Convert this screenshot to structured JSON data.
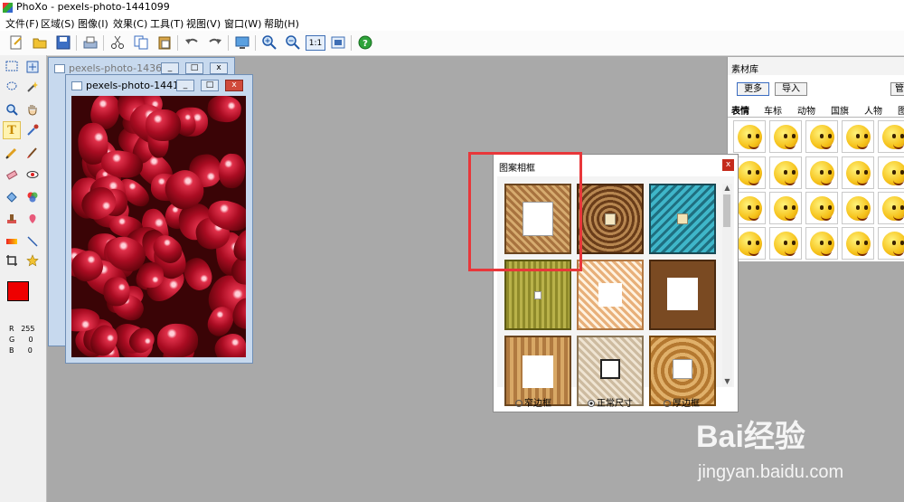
{
  "app": {
    "title": "PhoXo - pexels-photo-1441099"
  },
  "menu": [
    "文件(F)",
    "区域(S)",
    "图像(I)",
    "效果(C)",
    "工具(T)",
    "视图(V)",
    "窗口(W)",
    "帮助(H)"
  ],
  "toolbar": [
    "new-icon",
    "open-icon",
    "save-icon",
    "scan-icon",
    "cut-icon",
    "copy-icon",
    "paste-icon",
    "undo-icon",
    "redo-icon",
    "screen-capture-icon",
    "zoom-in-icon",
    "zoom-out-icon",
    "actual-size-icon",
    "fit-window-icon",
    "help-icon"
  ],
  "toolbar_labels": {
    "actual_size": "1:1"
  },
  "tools": [
    "rect-select-icon",
    "move-icon",
    "lasso-icon",
    "magic-wand-icon",
    "zoom-icon",
    "hand-icon",
    "text-icon",
    "eyedropper-icon",
    "pencil-icon",
    "brush-icon",
    "eraser-icon",
    "redeye-icon",
    "fill-icon",
    "colorize-icon",
    "stamp-icon",
    "heal-icon",
    "gradient-icon",
    "line-icon",
    "crop-icon",
    "star-icon"
  ],
  "colors": {
    "foreground": "#ee0000",
    "background": "#ffffff",
    "r_label": "R",
    "r": "255",
    "g_label": "G",
    "g": "0",
    "b_label": "B",
    "b": "0"
  },
  "windows": {
    "back": {
      "title": "pexels-photo-14361..."
    },
    "front": {
      "title": "pexels-photo-14410..."
    }
  },
  "library": {
    "title": "素材库",
    "more": "更多",
    "import": "导入",
    "manage": "管",
    "tabs": [
      "表情",
      "车标",
      "动物",
      "国旗",
      "人物",
      "图"
    ]
  },
  "frame_dialog": {
    "title": "图案相框",
    "close": "x",
    "options": [
      {
        "label": "窄边框",
        "checked": false
      },
      {
        "label": "正常尺寸",
        "checked": true
      },
      {
        "label": "厚边框",
        "checked": false
      }
    ]
  },
  "watermark": {
    "brand": "Bai经验",
    "url": "jingyan.baidu.com"
  }
}
